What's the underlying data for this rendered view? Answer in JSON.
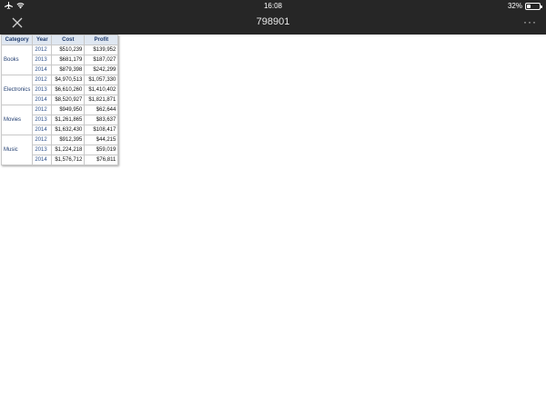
{
  "status": {
    "time": "16:08",
    "battery": "32%",
    "battery_level": 0.32
  },
  "nav": {
    "title": "798901",
    "more": "···"
  },
  "table": {
    "headers": [
      "Category",
      "Year",
      "Cost",
      "Profit"
    ],
    "groups": [
      {
        "category": "Books",
        "rows": [
          {
            "year": "2012",
            "cost": "$510,239",
            "profit": "$139,952"
          },
          {
            "year": "2013",
            "cost": "$681,179",
            "profit": "$187,027"
          },
          {
            "year": "2014",
            "cost": "$879,398",
            "profit": "$242,299"
          }
        ]
      },
      {
        "category": "Electronics",
        "rows": [
          {
            "year": "2012",
            "cost": "$4,970,513",
            "profit": "$1,057,330"
          },
          {
            "year": "2013",
            "cost": "$6,610,260",
            "profit": "$1,410,402"
          },
          {
            "year": "2014",
            "cost": "$8,520,927",
            "profit": "$1,821,871"
          }
        ]
      },
      {
        "category": "Movies",
        "rows": [
          {
            "year": "2012",
            "cost": "$949,950",
            "profit": "$62,644"
          },
          {
            "year": "2013",
            "cost": "$1,261,865",
            "profit": "$83,637"
          },
          {
            "year": "2014",
            "cost": "$1,632,430",
            "profit": "$108,417"
          }
        ]
      },
      {
        "category": "Music",
        "rows": [
          {
            "year": "2012",
            "cost": "$912,395",
            "profit": "$44,215"
          },
          {
            "year": "2013",
            "cost": "$1,224,218",
            "profit": "$59,019"
          },
          {
            "year": "2014",
            "cost": "$1,576,712",
            "profit": "$76,811"
          }
        ]
      }
    ]
  }
}
